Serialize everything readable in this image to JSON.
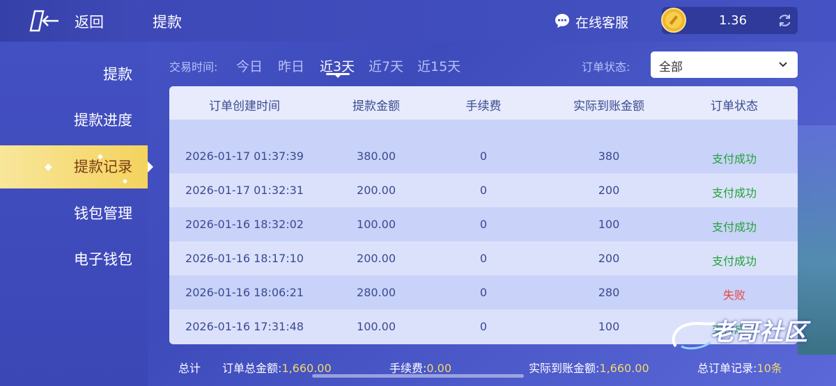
{
  "header": {
    "back_label": "返回",
    "page_title": "提款",
    "customer_service": "在线客服",
    "balance": "1.36"
  },
  "sidebar": {
    "items": [
      {
        "label": "提款"
      },
      {
        "label": "提款进度"
      },
      {
        "label": "提款记录"
      },
      {
        "label": "钱包管理"
      },
      {
        "label": "电子钱包"
      }
    ],
    "active_index": 2
  },
  "filters": {
    "time_label": "交易时间:",
    "tabs": [
      "今日",
      "昨日",
      "近3天",
      "近7天",
      "近15天"
    ],
    "active_tab": "近3天",
    "status_label": "订单状态:",
    "status_value": "全部"
  },
  "table": {
    "headers": [
      "订单创建时间",
      "提款金额",
      "手续费",
      "实际到账金额",
      "订单状态"
    ],
    "rows": [
      {
        "time": "2026-01-17 01:37:39",
        "amount": "380.00",
        "fee": "0",
        "actual": "380",
        "status": "支付成功",
        "status_type": "success"
      },
      {
        "time": "2026-01-17 01:32:31",
        "amount": "200.00",
        "fee": "0",
        "actual": "200",
        "status": "支付成功",
        "status_type": "success"
      },
      {
        "time": "2026-01-16 18:32:02",
        "amount": "100.00",
        "fee": "0",
        "actual": "100",
        "status": "支付成功",
        "status_type": "success"
      },
      {
        "time": "2026-01-16 18:17:10",
        "amount": "200.00",
        "fee": "0",
        "actual": "200",
        "status": "支付成功",
        "status_type": "success"
      },
      {
        "time": "2026-01-16 18:06:21",
        "amount": "280.00",
        "fee": "0",
        "actual": "280",
        "status": "失败",
        "status_type": "fail"
      },
      {
        "time": "2026-01-16 17:31:48",
        "amount": "100.00",
        "fee": "0",
        "actual": "100",
        "status": "支付成功",
        "status_type": "success"
      }
    ]
  },
  "footer": {
    "total_label": "总计",
    "order_total_label": "订单总金额:",
    "order_total_value": "1,660.00",
    "fee_label": "手续费:",
    "fee_value": "0.00",
    "actual_label": "实际到账金额:",
    "actual_value": "1,660.00",
    "records_label": "总订单记录:",
    "records_value": "10条"
  },
  "watermark": "老哥社区",
  "colors": {
    "success": "#22a33a",
    "fail": "#e84646",
    "accent_gold": "#f5d96a"
  }
}
